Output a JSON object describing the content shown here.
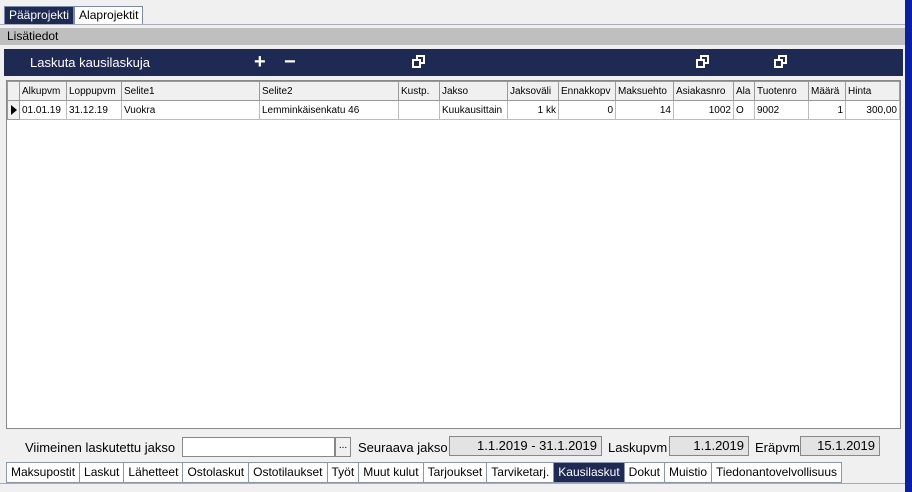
{
  "top_tabs": [
    {
      "label": "Pääprojekti",
      "active": true
    },
    {
      "label": "Alaprojektit",
      "active": false
    }
  ],
  "section_label": "Lisätiedot",
  "header": {
    "title": "Laskuta kausilaskuja",
    "add_icon": "plus-icon",
    "remove_icon": "minus-icon",
    "copy_icon": "copy-icon"
  },
  "table": {
    "columns": [
      "Alkupvm",
      "Loppupvm",
      "Selite1",
      "Selite2",
      "Kustp.",
      "Jakso",
      "Jaksoväli",
      "Ennakkopv",
      "Maksuehto",
      "Asiakasnro",
      "Ala",
      "Tuotenro",
      "Määrä",
      "Hinta"
    ],
    "rows": [
      [
        "01.01.19",
        "31.12.19",
        "Vuokra",
        "Lemminkäisenkatu 46",
        "",
        "Kuukausittain",
        "1 kk",
        "0",
        "14",
        "1002",
        "O",
        "9002",
        "1",
        "300,00"
      ]
    ]
  },
  "footer": {
    "last_billed_label": "Viimeinen laskutettu jakso",
    "last_billed_value": "",
    "browse_label": "...",
    "next_period_label": "Seuraava jakso",
    "next_period_value": "1.1.2019 - 31.1.2019",
    "invoice_date_label": "Laskupvm",
    "invoice_date_value": "1.1.2019",
    "due_date_label": "Eräpvm",
    "due_date_value": "15.1.2019"
  },
  "bottom_tabs": [
    {
      "label": "Maksupostit",
      "active": false
    },
    {
      "label": "Laskut",
      "active": false
    },
    {
      "label": "Lähetteet",
      "active": false
    },
    {
      "label": "Ostolaskut",
      "active": false
    },
    {
      "label": "Ostotilaukset",
      "active": false
    },
    {
      "label": "Työt",
      "active": false
    },
    {
      "label": "Muut kulut",
      "active": false
    },
    {
      "label": "Tarjoukset",
      "active": false
    },
    {
      "label": "Tarviketarj.",
      "active": false
    },
    {
      "label": "Kausilaskut",
      "active": true
    },
    {
      "label": "Dokut",
      "active": false
    },
    {
      "label": "Muistio",
      "active": false
    },
    {
      "label": "Tiedonantovelvollisuus",
      "active": false
    }
  ]
}
